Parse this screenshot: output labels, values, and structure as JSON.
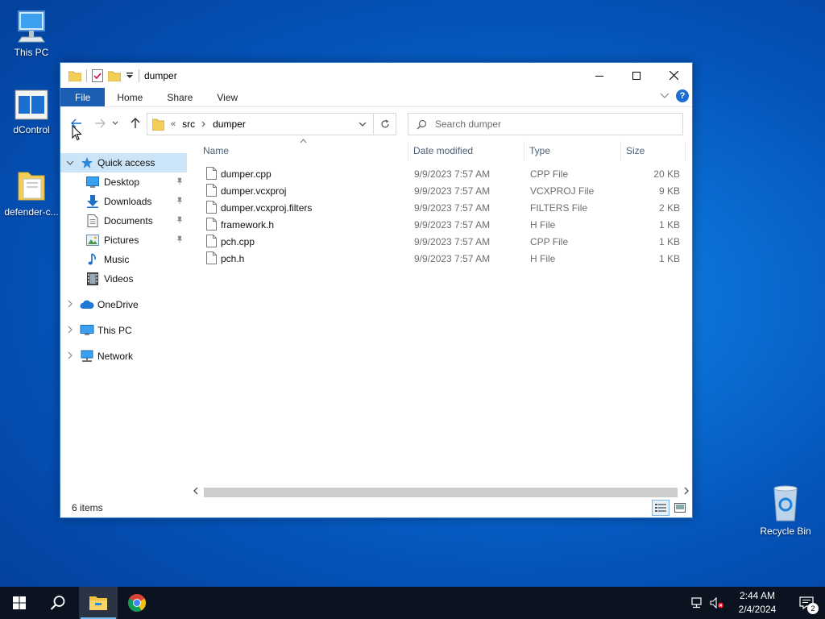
{
  "desktop": {
    "icons": [
      {
        "label": "This PC"
      },
      {
        "label": "dControl"
      },
      {
        "label": "defender-c..."
      },
      {
        "label": "Recycle Bin"
      }
    ]
  },
  "window": {
    "title": "dumper",
    "ribbon_tabs": [
      "File",
      "Home",
      "Share",
      "View"
    ],
    "help_label": "?",
    "breadcrumb": {
      "overflow": "«",
      "parts": [
        "src",
        "dumper"
      ]
    },
    "search": {
      "placeholder": "Search dumper"
    },
    "sidebar": {
      "quick_access": "Quick access",
      "pinned": [
        {
          "label": "Desktop"
        },
        {
          "label": "Downloads"
        },
        {
          "label": "Documents"
        },
        {
          "label": "Pictures"
        },
        {
          "label": "Music"
        },
        {
          "label": "Videos"
        }
      ],
      "onedrive": "OneDrive",
      "this_pc": "This PC",
      "network": "Network"
    },
    "columns": {
      "name": "Name",
      "date": "Date modified",
      "type": "Type",
      "size": "Size"
    },
    "files": [
      {
        "name": "dumper.cpp",
        "date": "9/9/2023 7:57 AM",
        "type": "CPP File",
        "size": "20 KB"
      },
      {
        "name": "dumper.vcxproj",
        "date": "9/9/2023 7:57 AM",
        "type": "VCXPROJ File",
        "size": "9 KB"
      },
      {
        "name": "dumper.vcxproj.filters",
        "date": "9/9/2023 7:57 AM",
        "type": "FILTERS File",
        "size": "2 KB"
      },
      {
        "name": "framework.h",
        "date": "9/9/2023 7:57 AM",
        "type": "H File",
        "size": "1 KB"
      },
      {
        "name": "pch.cpp",
        "date": "9/9/2023 7:57 AM",
        "type": "CPP File",
        "size": "1 KB"
      },
      {
        "name": "pch.h",
        "date": "9/9/2023 7:57 AM",
        "type": "H File",
        "size": "1 KB"
      }
    ],
    "status": "6 items"
  },
  "taskbar": {
    "time": "2:44 AM",
    "date": "2/4/2024",
    "notification_count": "2"
  },
  "colors": {
    "accent": "#1a5fb4",
    "selection": "#cce4f7",
    "taskbar": "#0b1320"
  }
}
